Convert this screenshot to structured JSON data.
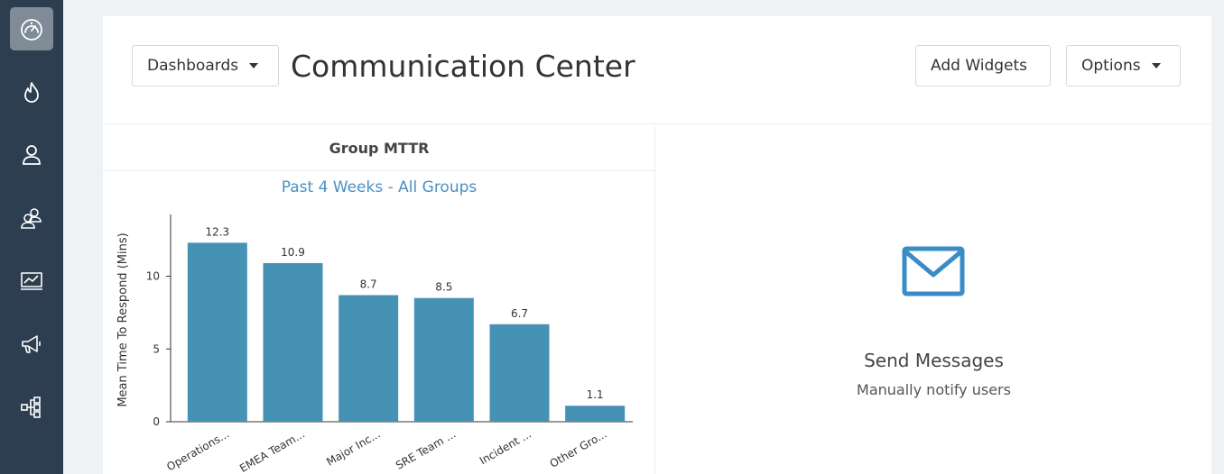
{
  "header": {
    "dashboards_label": "Dashboards",
    "title": "Communication Center",
    "add_widgets_label": "Add Widgets",
    "options_label": "Options"
  },
  "sidebar": {
    "items": [
      {
        "icon": "speedometer-icon",
        "active": true
      },
      {
        "icon": "flame-icon",
        "active": false
      },
      {
        "icon": "user-icon",
        "active": false
      },
      {
        "icon": "group-icon",
        "active": false
      },
      {
        "icon": "analytics-monitor-icon",
        "active": false
      },
      {
        "icon": "megaphone-icon",
        "active": false
      },
      {
        "icon": "hierarchy-icon",
        "active": false
      }
    ]
  },
  "widgets": {
    "mttr": {
      "panel_title": "Group MTTR",
      "subtitle": "Past 4 Weeks - All Groups"
    },
    "send_messages": {
      "icon": "envelope-icon",
      "title": "Send Messages",
      "subtitle": "Manually notify users"
    }
  },
  "colors": {
    "sidebar_bg": "#2c3e50",
    "bar": "#4592b5",
    "accent": "#4a90c2"
  },
  "chart_data": {
    "type": "bar",
    "categories": [
      "Operations...",
      "EMEA Team...",
      "Major Inc...",
      "SRE Team ...",
      "Incident ...",
      "Other Gro..."
    ],
    "values": [
      12.3,
      10.9,
      8.7,
      8.5,
      6.7,
      1.1
    ],
    "value_labels": [
      "12.3",
      "10.9",
      "8.7",
      "8.5",
      "6.7",
      "1.1"
    ],
    "ylabel": "Mean Time To Respond (Mins)",
    "yticks": [
      0,
      5,
      10
    ],
    "ylim": [
      0,
      13.5
    ],
    "grid": false,
    "legend": "none"
  }
}
